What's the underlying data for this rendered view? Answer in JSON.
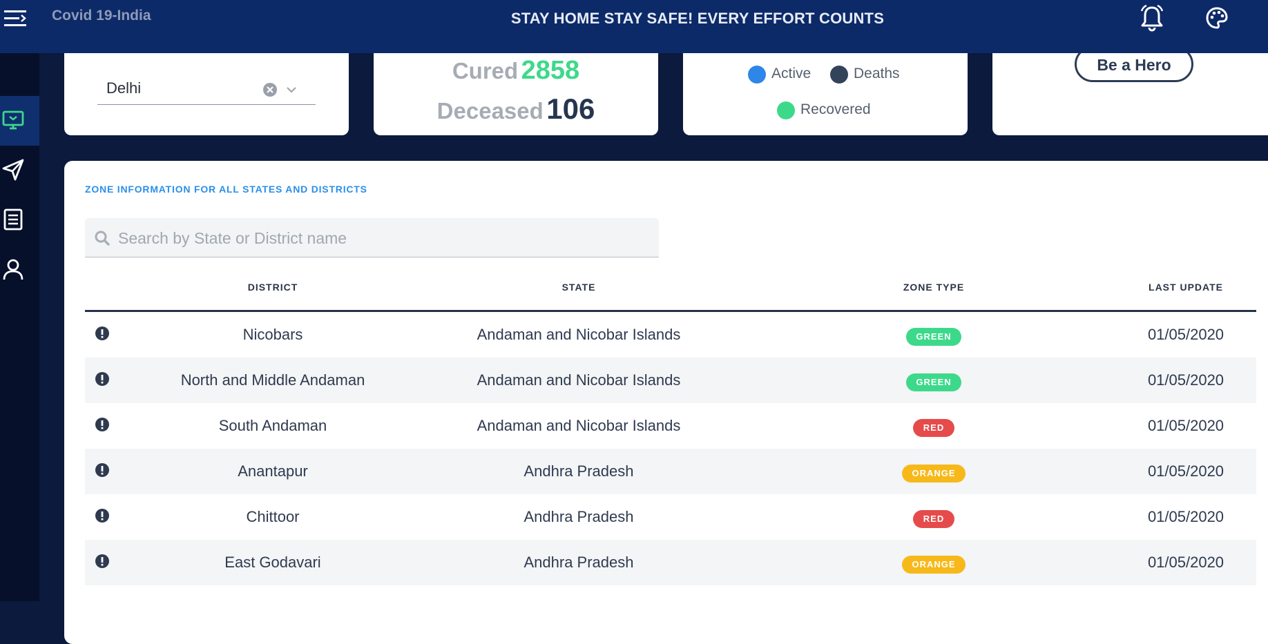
{
  "header": {
    "app_title": "Covid 19-India",
    "banner": "STAY HOME STAY SAFE! EVERY EFFORT COUNTS"
  },
  "sidebar": {
    "items": [
      {
        "icon": "monitor-icon",
        "active": true
      },
      {
        "icon": "send-icon",
        "active": false
      },
      {
        "icon": "document-icon",
        "active": false
      },
      {
        "icon": "user-icon",
        "active": false
      }
    ]
  },
  "state_select": {
    "value": "Delhi"
  },
  "stats": {
    "cured_label": "Cured",
    "cured_value": "2858",
    "deceased_label": "Deceased",
    "deceased_value": "106"
  },
  "legend": [
    {
      "label": "Active",
      "color": "#2e86e8"
    },
    {
      "label": "Deaths",
      "color": "#33435a"
    },
    {
      "label": "Recovered",
      "color": "#3dd98b"
    }
  ],
  "hero_button": "Be a Hero",
  "zone": {
    "title": "ZONE INFORMATION FOR ALL STATES AND DISTRICTS",
    "search_placeholder": "Search by State or District name",
    "columns": [
      "DISTRICT",
      "STATE",
      "ZONE TYPE",
      "LAST UPDATE"
    ],
    "rows": [
      {
        "district": "Nicobars",
        "state": "Andaman and Nicobar Islands",
        "zone": "GREEN",
        "updated": "01/05/2020"
      },
      {
        "district": "North and Middle Andaman",
        "state": "Andaman and Nicobar Islands",
        "zone": "GREEN",
        "updated": "01/05/2020"
      },
      {
        "district": "South Andaman",
        "state": "Andaman and Nicobar Islands",
        "zone": "RED",
        "updated": "01/05/2020"
      },
      {
        "district": "Anantapur",
        "state": "Andhra Pradesh",
        "zone": "ORANGE",
        "updated": "01/05/2020"
      },
      {
        "district": "Chittoor",
        "state": "Andhra Pradesh",
        "zone": "RED",
        "updated": "01/05/2020"
      },
      {
        "district": "East Godavari",
        "state": "Andhra Pradesh",
        "zone": "ORANGE",
        "updated": "01/05/2020"
      }
    ],
    "zone_colors": {
      "GREEN": "#3dd98b",
      "RED": "#e54b4b",
      "ORANGE": "#f7b91a"
    }
  }
}
